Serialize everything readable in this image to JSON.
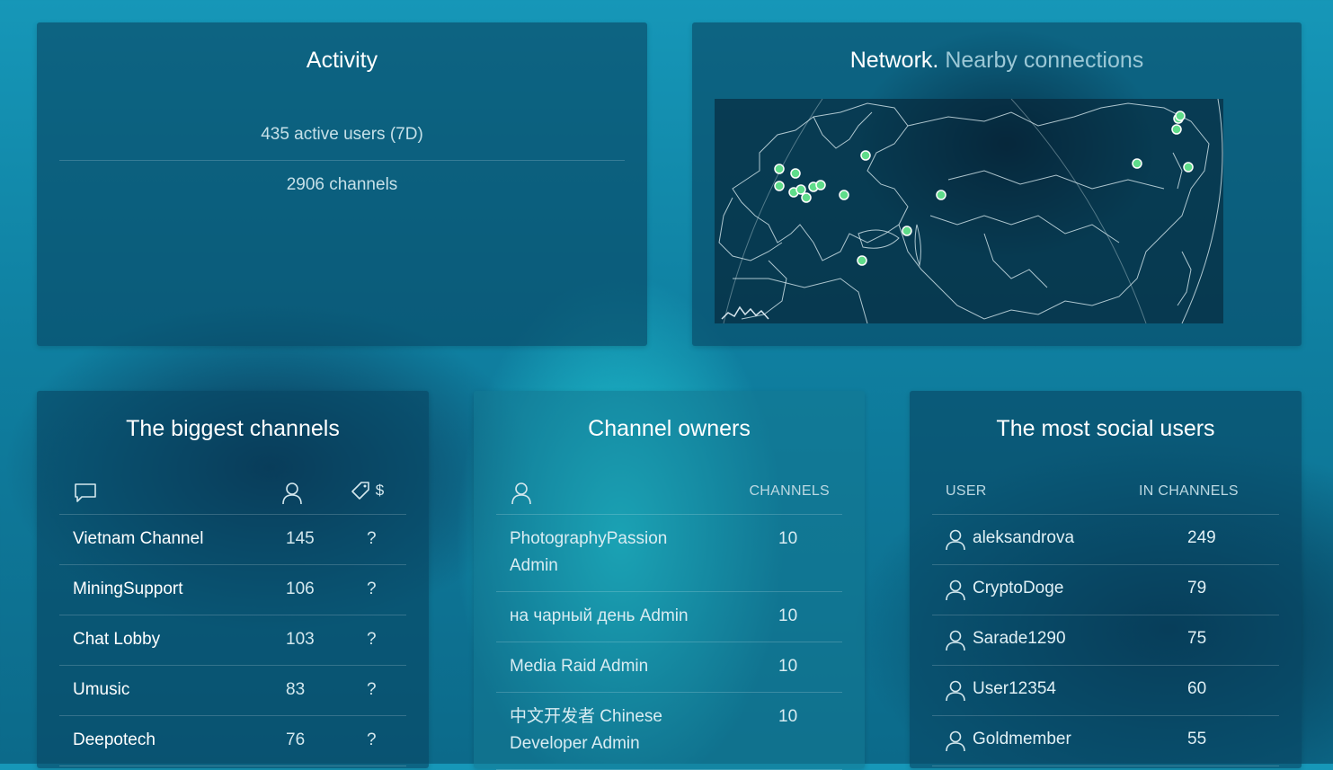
{
  "activity": {
    "title": "Activity",
    "active_users": "435 active users (7D)",
    "channels": "2906 channels"
  },
  "network": {
    "title_main": "Network.",
    "title_sub": "Nearby connections",
    "marker_color": "#5fdc8a"
  },
  "biggest_channels": {
    "title": "The biggest channels",
    "header_icons": [
      "chat-icon",
      "user-icon",
      "price-tag-icon"
    ],
    "price_header_symbol": "$",
    "rows": [
      {
        "name": "Vietnam Channel",
        "users": "145",
        "price": "?"
      },
      {
        "name": "MiningSupport",
        "users": "106",
        "price": "?"
      },
      {
        "name": "Chat Lobby",
        "users": "103",
        "price": "?"
      },
      {
        "name": "Umusic",
        "users": "83",
        "price": "?"
      },
      {
        "name": "Deepotech",
        "users": "76",
        "price": "?"
      }
    ]
  },
  "channel_owners": {
    "title": "Channel owners",
    "header_channels": "CHANNELS",
    "rows": [
      {
        "name_line1": "PhotographyPassion",
        "name_line2": "Admin",
        "count": "10"
      },
      {
        "name_line1": "на чарный день Admin",
        "name_line2": "",
        "count": "10"
      },
      {
        "name_line1": "Media Raid Admin",
        "name_line2": "",
        "count": "10"
      },
      {
        "name_line1": "中文开发者 Chinese",
        "name_line2": "Developer Admin",
        "count": "10"
      }
    ]
  },
  "social_users": {
    "title": "The most social users",
    "header_user": "USER",
    "header_channels": "IN CHANNELS",
    "rows": [
      {
        "name": "aleksandrova",
        "count": "249"
      },
      {
        "name": "CryptoDoge",
        "count": "79"
      },
      {
        "name": "Sarade1290",
        "count": "75"
      },
      {
        "name": "User12354",
        "count": "60"
      },
      {
        "name": "Goldmember",
        "count": "55"
      }
    ]
  }
}
